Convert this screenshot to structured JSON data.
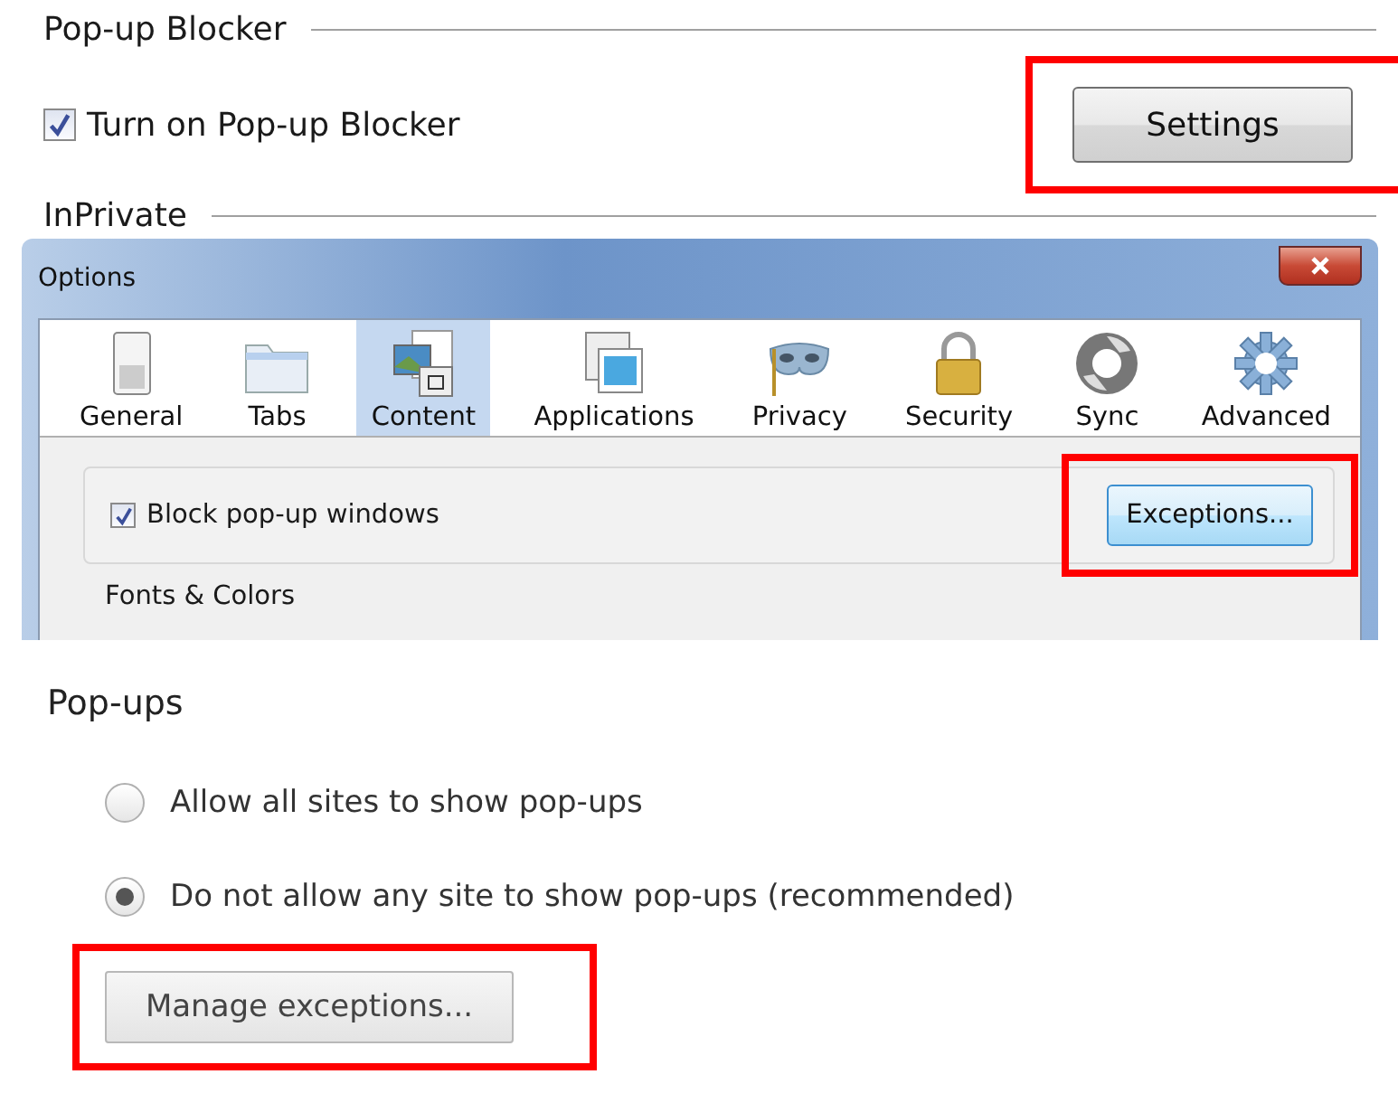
{
  "ie": {
    "heading": "Pop-up Blocker",
    "checkbox": {
      "label": "Turn on Pop-up Blocker",
      "checked": true
    },
    "button": {
      "label": "Settings",
      "highlighted": true
    },
    "next_heading": "InPrivate"
  },
  "firefox": {
    "window": {
      "title": "Options"
    },
    "tabs": [
      {
        "label": "General",
        "selected": false
      },
      {
        "label": "Tabs",
        "selected": false
      },
      {
        "label": "Content",
        "selected": true
      },
      {
        "label": "Applications",
        "selected": false
      },
      {
        "label": "Privacy",
        "selected": false
      },
      {
        "label": "Security",
        "selected": false
      },
      {
        "label": "Sync",
        "selected": false
      },
      {
        "label": "Advanced",
        "selected": false
      }
    ],
    "checkbox": {
      "label": "Block pop-up windows",
      "checked": true
    },
    "button": {
      "label": "Exceptions...",
      "highlighted": true
    },
    "next_group": "Fonts & Colors"
  },
  "chrome": {
    "heading": "Pop-ups",
    "options": [
      {
        "label": "Allow all sites to show pop-ups",
        "selected": false
      },
      {
        "label": "Do not allow any site to show pop-ups (recommended)",
        "selected": true
      }
    ],
    "button": {
      "label": "Manage exceptions...",
      "highlighted": true
    }
  }
}
